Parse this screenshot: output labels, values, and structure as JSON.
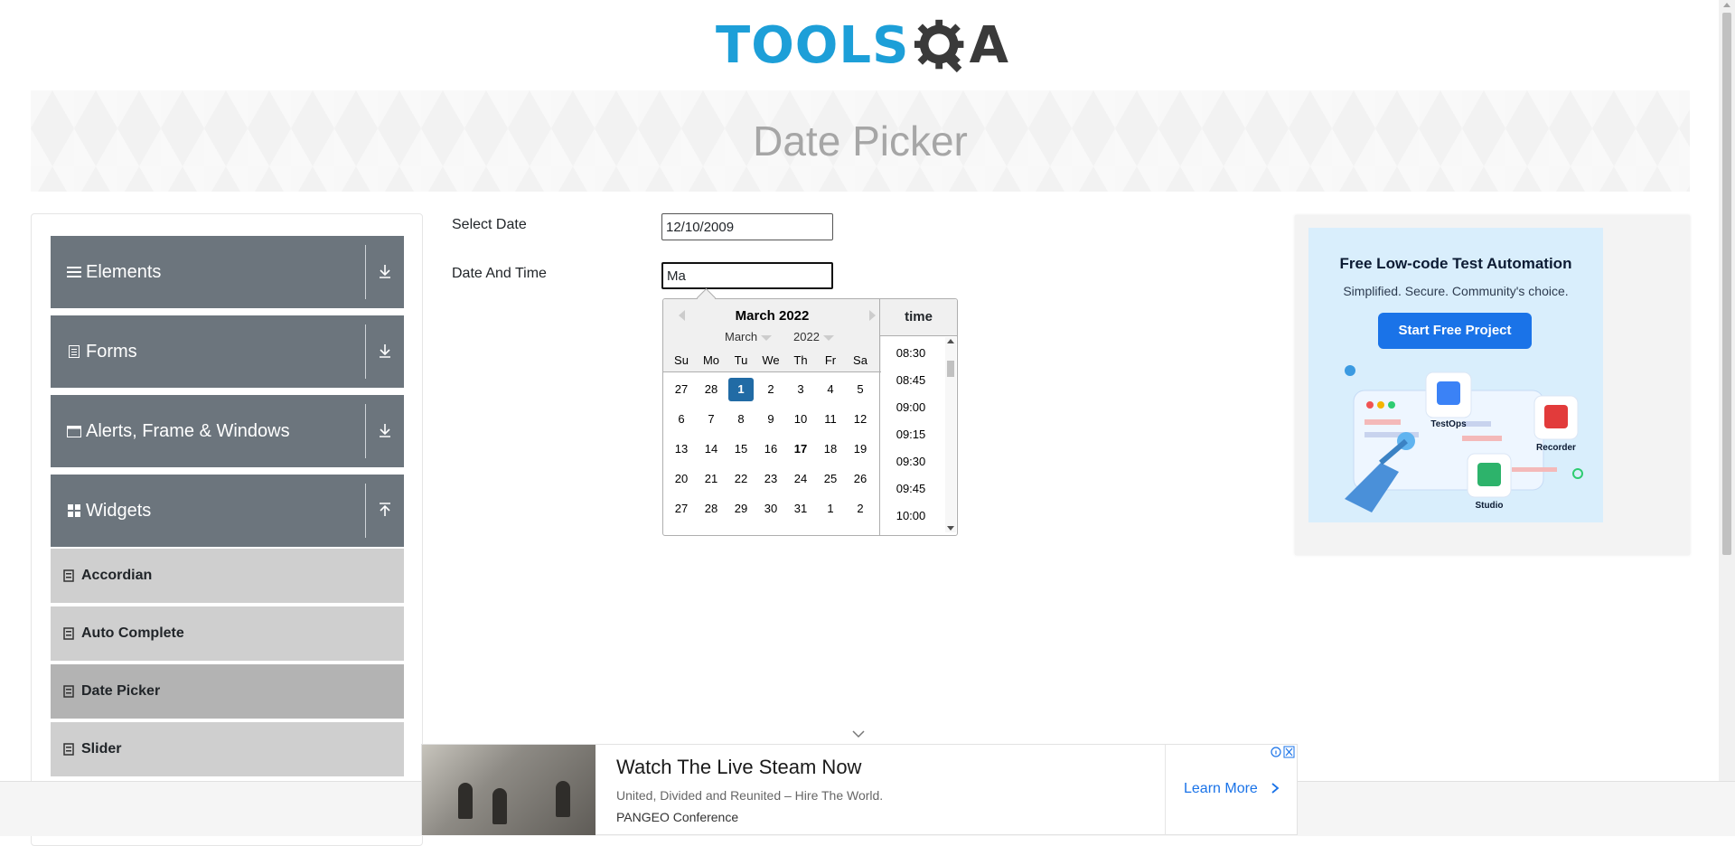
{
  "header": {
    "logo_text_left": "TOOLS",
    "logo_text_right": "A"
  },
  "banner": {
    "title": "Date Picker"
  },
  "sidebar": {
    "groups": [
      {
        "label": "Elements",
        "icon": "hamburger-icon",
        "state": "collapsed"
      },
      {
        "label": "Forms",
        "icon": "form-icon",
        "state": "collapsed"
      },
      {
        "label": "Alerts, Frame & Windows",
        "icon": "window-icon",
        "state": "collapsed"
      },
      {
        "label": "Widgets",
        "icon": "widgets-icon",
        "state": "expanded"
      }
    ],
    "items": [
      {
        "label": "Accordian",
        "active": false
      },
      {
        "label": "Auto Complete",
        "active": false
      },
      {
        "label": "Date Picker",
        "active": true
      },
      {
        "label": "Slider",
        "active": false
      }
    ]
  },
  "form": {
    "select_date_label": "Select Date",
    "select_date_value": "12/10/2009",
    "date_time_label": "Date And Time",
    "date_time_value": "Ma"
  },
  "datepicker": {
    "title": "March 2022",
    "month_select": "March",
    "year_select": "2022",
    "weekdays": [
      "Su",
      "Mo",
      "Tu",
      "We",
      "Th",
      "Fr",
      "Sa"
    ],
    "weeks": [
      [
        "27",
        "28",
        "1",
        "2",
        "3",
        "4",
        "5"
      ],
      [
        "6",
        "7",
        "8",
        "9",
        "10",
        "11",
        "12"
      ],
      [
        "13",
        "14",
        "15",
        "16",
        "17",
        "18",
        "19"
      ],
      [
        "20",
        "21",
        "22",
        "23",
        "24",
        "25",
        "26"
      ],
      [
        "27",
        "28",
        "29",
        "30",
        "31",
        "1",
        "2"
      ]
    ],
    "selected_day": "1",
    "today_day": "17",
    "time_header": "time",
    "times": [
      "08:30",
      "08:45",
      "09:00",
      "09:15",
      "09:30",
      "09:45",
      "10:00"
    ]
  },
  "right_ad": {
    "title": "Free Low-code Test Automation",
    "subtitle": "Simplified. Secure. Community's choice.",
    "cta": "Start Free Project",
    "badges": [
      "TestOps",
      "Recorder",
      "Studio"
    ]
  },
  "bottom_ad": {
    "headline": "Watch The Live Steam Now",
    "description": "United, Divided and Reunited – Hire The World.",
    "brand": "PANGEO Conference",
    "cta": "Learn More"
  },
  "colors": {
    "logo_blue": "#1d9fd8",
    "sidebar_group": "#6c757d",
    "sidebar_item": "#cfcfcf",
    "sidebar_item_active": "#b3b3b3",
    "selected_day": "#216ba5",
    "cta_blue": "#1a73e8"
  }
}
